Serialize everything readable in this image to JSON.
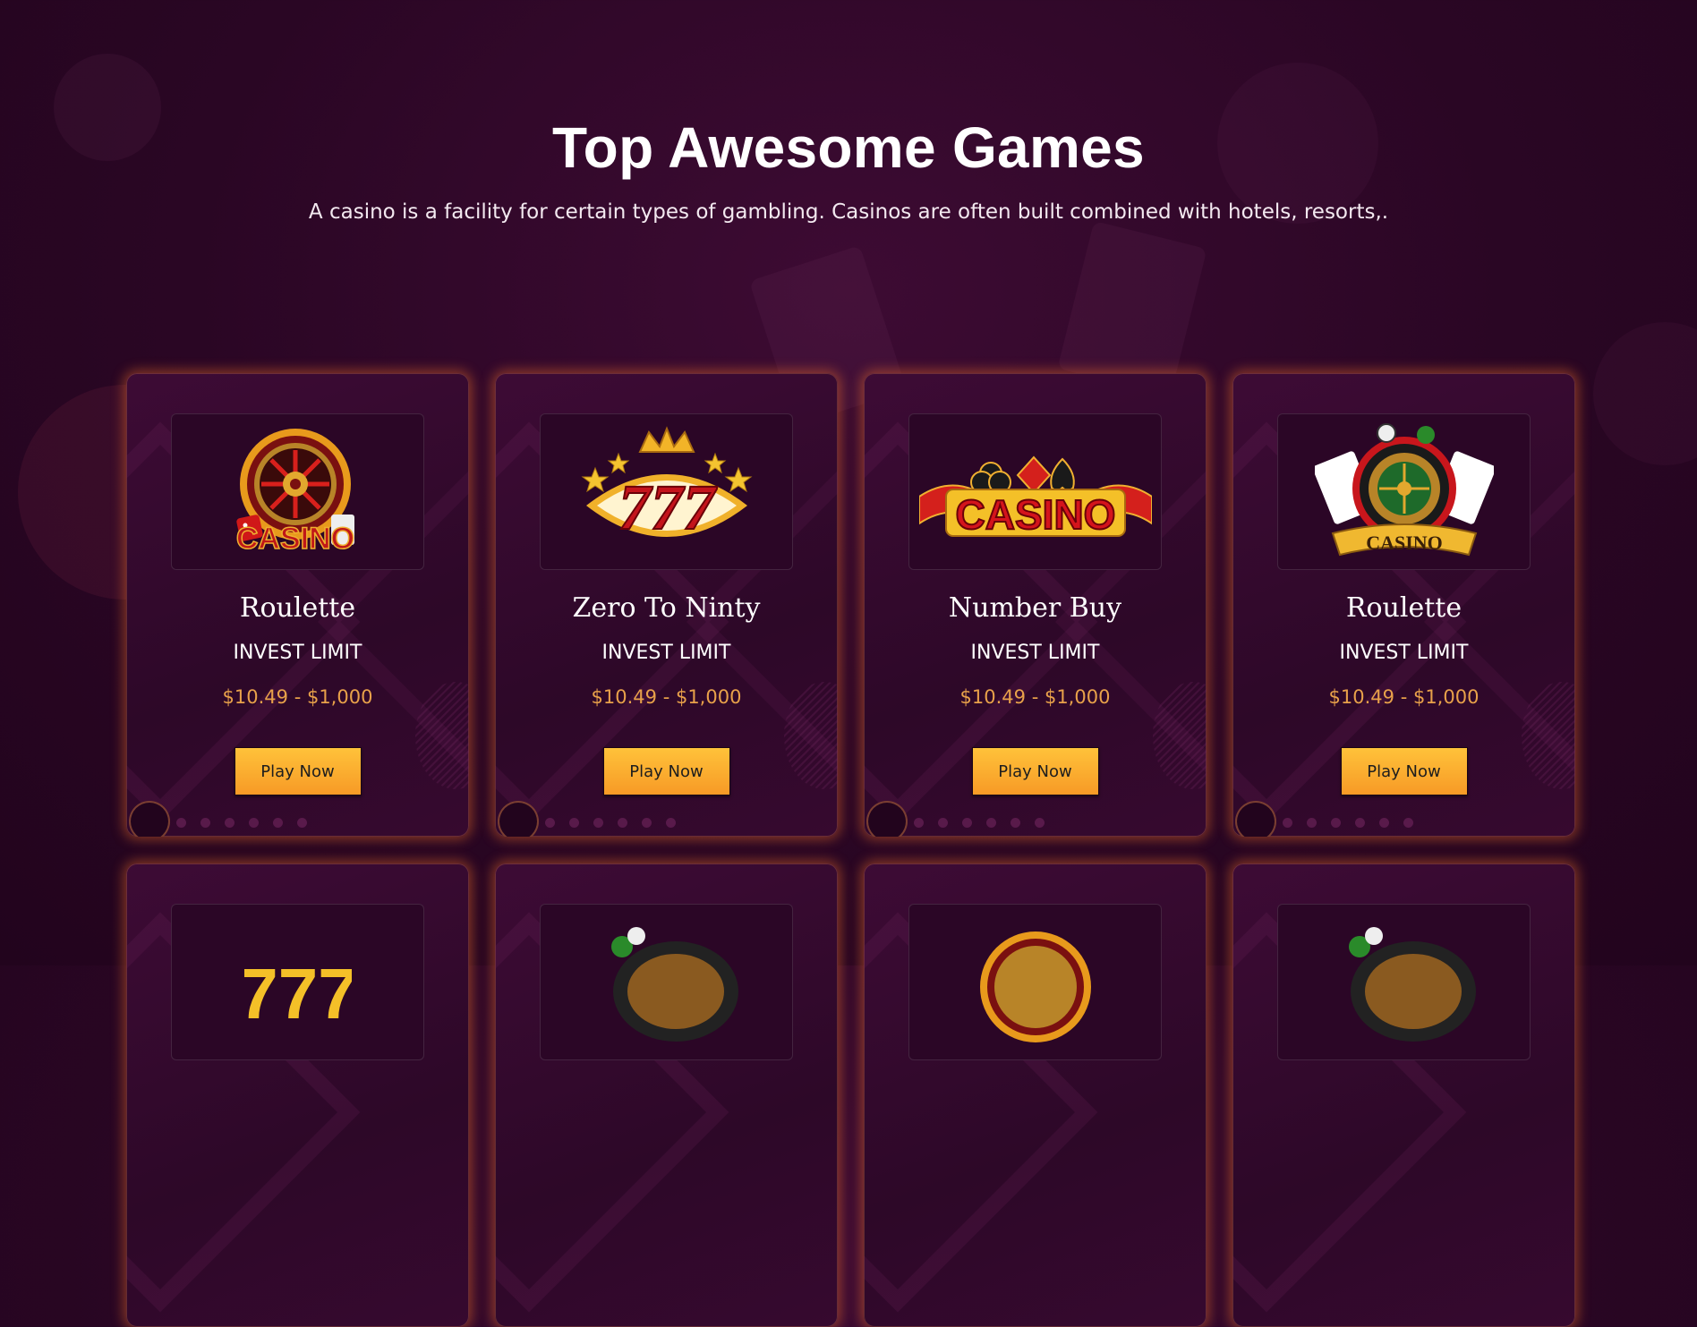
{
  "section": {
    "title": "Top Awesome Games",
    "subtitle": "A casino is a facility for certain types of gambling. Casinos are often built combined with hotels, resorts,."
  },
  "colors": {
    "background": "#2a0624",
    "card": "#3d0b35",
    "accent_gold": "#e8a14a",
    "button_top": "#ffc23a",
    "button_bottom": "#f79a26",
    "glow": "#ff7828"
  },
  "games": [
    {
      "name": "Roulette",
      "icon": "casino-roulette-logo-icon",
      "limit_label": "INVEST LIMIT",
      "limit": "$10.49 - $1,000",
      "button": "Play Now"
    },
    {
      "name": "Zero To Ninty",
      "icon": "777-slot-crown-icon",
      "limit_label": "INVEST LIMIT",
      "limit": "$10.49 - $1,000",
      "button": "Play Now"
    },
    {
      "name": "Number Buy",
      "icon": "casino-banner-suits-icon",
      "limit_label": "INVEST LIMIT",
      "limit": "$10.49 - $1,000",
      "button": "Play Now"
    },
    {
      "name": "Roulette",
      "icon": "roulette-cards-casino-icon",
      "limit_label": "INVEST LIMIT",
      "limit": "$10.49 - $1,000",
      "button": "Play Now"
    }
  ],
  "row2_icons": [
    "777-slot-icon",
    "roulette-wheel-chips-icon",
    "casino-roulette-logo-icon",
    "roulette-wheel-chips-icon"
  ]
}
